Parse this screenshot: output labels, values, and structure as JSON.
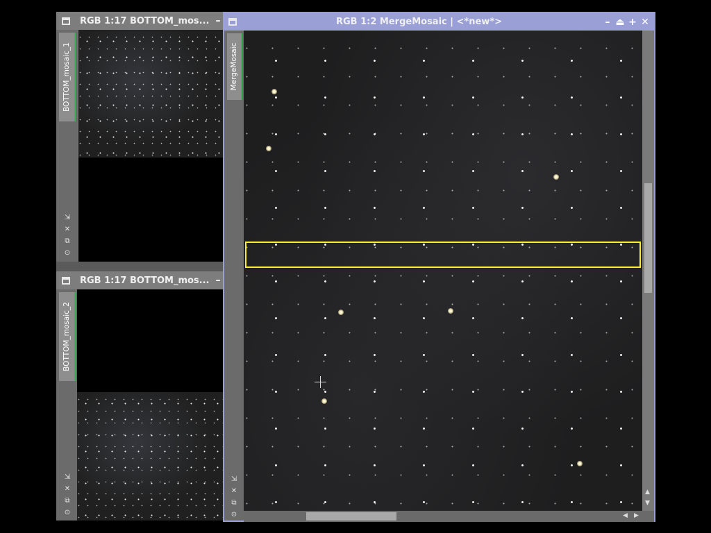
{
  "windows": {
    "top_left": {
      "title": "RGB 1:17 BOTTOM_mos...",
      "tab_label": "BOTTOM_mosaic_1",
      "minimize_icon": "minimize-icon"
    },
    "bottom_left": {
      "title": "RGB 1:17 BOTTOM_mos...",
      "tab_label": "BOTTOM_mosaic_2",
      "minimize_icon": "minimize-icon"
    },
    "main": {
      "title": "RGB 1:2 MergeMosaic | <*new*>",
      "tab_label": "MergeMosaic",
      "controls": [
        "minimize-icon",
        "shade-icon",
        "maximize-icon",
        "close-icon"
      ]
    }
  },
  "side_tools": [
    "zoom-fit-icon",
    "crosshair-icon",
    "clone-icon",
    "target-icon"
  ],
  "selection": {
    "color": "#ffee33"
  },
  "colors": {
    "active_title": "#9aa0d6",
    "inactive_title": "#7d7d7d",
    "tab_accent": "#3fb15b"
  }
}
